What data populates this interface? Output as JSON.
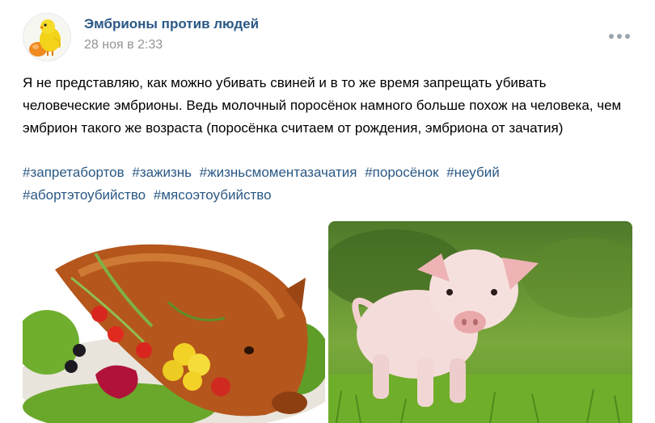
{
  "post": {
    "author": {
      "name": "Эмбрионы против людей",
      "avatar_icon": "chick-on-egg-icon"
    },
    "date": "28 ноя в 2:33",
    "text": "Я не представляю, как можно убивать свиней и в то же время запрещать убивать человеческие эмбрионы. Ведь молочный поросёнок намного больше похож на человека, чем эмбрион такого же возраста (поросёнка считаем от рождения, эмбриона от зачатия)",
    "hashtags": [
      "#запретабортов",
      "#зажизнь",
      "#жизньсмоментазачатия",
      "#поросёнок",
      "#неубий",
      "#абортэтоубийство",
      "#мясоэтоубийство"
    ],
    "photos": [
      {
        "subject": "roasted-suckling-pig-with-vegetables"
      },
      {
        "subject": "live-piglet-on-grass"
      }
    ]
  },
  "colors": {
    "link": "#2a5885",
    "date": "#939393",
    "text": "#000000",
    "more_dots": "#99a2ad"
  }
}
